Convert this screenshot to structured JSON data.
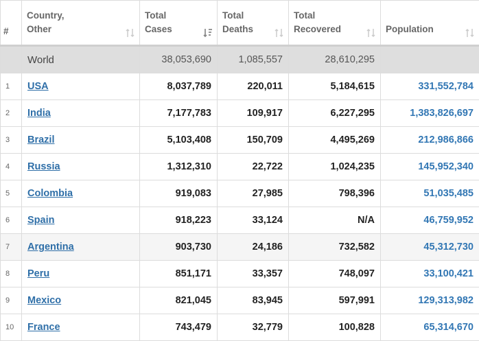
{
  "header": {
    "rank": "#",
    "country_line1": "Country,",
    "country_line2": "Other",
    "cases_line1": "Total",
    "cases_line2": "Cases",
    "deaths_line1": "Total",
    "deaths_line2": "Deaths",
    "recovered_line1": "Total",
    "recovered_line2": "Recovered",
    "population": "Population"
  },
  "sort_state": {
    "active_column": "Total Cases",
    "direction": "descending"
  },
  "colors": {
    "link": "#2f6fa8",
    "population": "#3277b4",
    "world_row_bg": "#dedede",
    "alt_row_bg": "#f5f5f5"
  },
  "world": {
    "name": "World",
    "cases": "38,053,690",
    "deaths": "1,085,557",
    "recovered": "28,610,295",
    "population": ""
  },
  "rows": [
    {
      "rank": "1",
      "country": "USA",
      "cases": "8,037,789",
      "deaths": "220,011",
      "recovered": "5,184,615",
      "population": "331,552,784"
    },
    {
      "rank": "2",
      "country": "India",
      "cases": "7,177,783",
      "deaths": "109,917",
      "recovered": "6,227,295",
      "population": "1,383,826,697"
    },
    {
      "rank": "3",
      "country": "Brazil",
      "cases": "5,103,408",
      "deaths": "150,709",
      "recovered": "4,495,269",
      "population": "212,986,866"
    },
    {
      "rank": "4",
      "country": "Russia",
      "cases": "1,312,310",
      "deaths": "22,722",
      "recovered": "1,024,235",
      "population": "145,952,340"
    },
    {
      "rank": "5",
      "country": "Colombia",
      "cases": "919,083",
      "deaths": "27,985",
      "recovered": "798,396",
      "population": "51,035,485"
    },
    {
      "rank": "6",
      "country": "Spain",
      "cases": "918,223",
      "deaths": "33,124",
      "recovered": "N/A",
      "population": "46,759,952"
    },
    {
      "rank": "7",
      "country": "Argentina",
      "cases": "903,730",
      "deaths": "24,186",
      "recovered": "732,582",
      "population": "45,312,730"
    },
    {
      "rank": "8",
      "country": "Peru",
      "cases": "851,171",
      "deaths": "33,357",
      "recovered": "748,097",
      "population": "33,100,421"
    },
    {
      "rank": "9",
      "country": "Mexico",
      "cases": "821,045",
      "deaths": "83,945",
      "recovered": "597,991",
      "population": "129,313,982"
    },
    {
      "rank": "10",
      "country": "France",
      "cases": "743,479",
      "deaths": "32,779",
      "recovered": "100,828",
      "population": "65,314,670"
    }
  ]
}
